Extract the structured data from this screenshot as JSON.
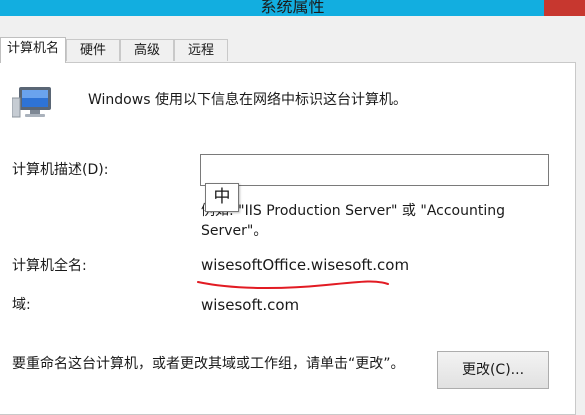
{
  "window": {
    "title": "系统属性"
  },
  "tabs": [
    {
      "label": "计算机名",
      "active": true
    },
    {
      "label": "硬件",
      "active": false
    },
    {
      "label": "高级",
      "active": false
    },
    {
      "label": "远程",
      "active": false
    }
  ],
  "panel": {
    "intro": "Windows 使用以下信息在网络中标识这台计算机。",
    "description_label": "计算机描述(D):",
    "description_value": "",
    "example_text": "例如: \"IIS Production Server\" 或 \"Accounting Server\"。",
    "full_name_label": "计算机全名:",
    "full_name_value": "wisesoftOffice.wisesoft.com",
    "domain_label": "域:",
    "domain_value": "wisesoft.com",
    "rename_text": "要重命名这台计算机，或者更改其域或工作组，请单击“更改”。",
    "change_button": "更改(C)..."
  },
  "ime": {
    "label": "中"
  },
  "colors": {
    "titlebar": "#12aee0",
    "close": "#c7372f",
    "annotation": "#e21b23"
  },
  "icons": [
    "computer-icon",
    "close-icon"
  ]
}
